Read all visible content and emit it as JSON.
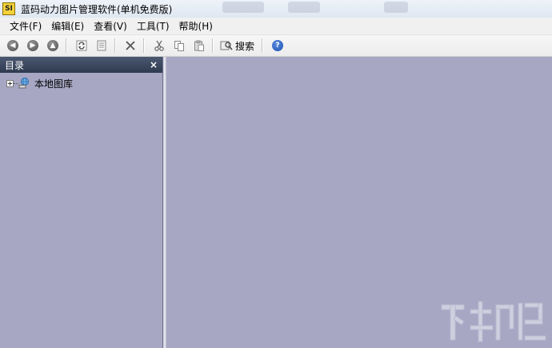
{
  "window": {
    "title": "蓝码动力图片管理软件(单机免费版)",
    "app_icon_text": "SI"
  },
  "menu": [
    {
      "label": "文件(F)"
    },
    {
      "label": "编辑(E)"
    },
    {
      "label": "查看(V)"
    },
    {
      "label": "工具(T)"
    },
    {
      "label": "帮助(H)"
    }
  ],
  "toolbar": {
    "search_label": "搜索",
    "icons": [
      "back-icon",
      "forward-icon",
      "up-icon",
      "refresh-icon",
      "properties-icon",
      "delete-icon",
      "cut-icon",
      "copy-icon",
      "paste-icon",
      "search-icon",
      "help-icon"
    ]
  },
  "left_panel": {
    "title": "目录",
    "close": "×",
    "tree": [
      {
        "label": "本地图库",
        "icon": "globe-computer-icon"
      }
    ]
  },
  "colors": {
    "background": "#a7a7c4",
    "panel_header": "#2e3a4f",
    "app_icon": "#f3d23a"
  }
}
